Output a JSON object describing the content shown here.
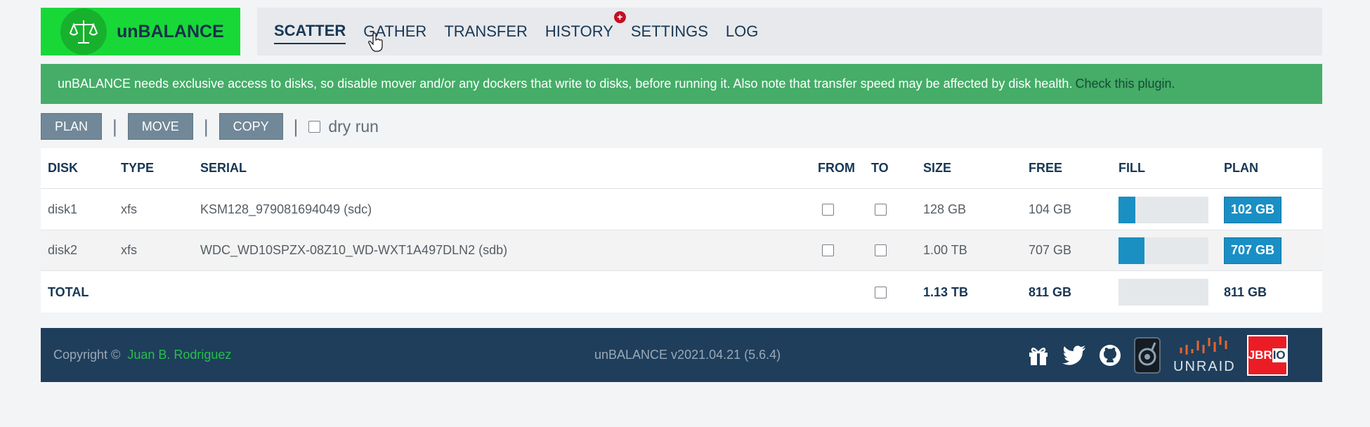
{
  "app": {
    "logo_text": "unBALANCE"
  },
  "nav": {
    "tabs": [
      {
        "label": "SCATTER",
        "active": true
      },
      {
        "label": "GATHER"
      },
      {
        "label": "TRANSFER"
      },
      {
        "label": "HISTORY",
        "badge": "+"
      },
      {
        "label": "SETTINGS"
      },
      {
        "label": "LOG"
      }
    ]
  },
  "alert": {
    "message": "unBALANCE needs exclusive access to disks, so disable mover and/or any dockers that write to disks, before running it. Also note that transfer speed may be affected by disk health.",
    "link": "Check this plugin."
  },
  "toolbar": {
    "plan_label": "PLAN",
    "move_label": "MOVE",
    "copy_label": "COPY",
    "separator": "|",
    "dry_run_label": "dry run",
    "dry_run_checked": false
  },
  "table": {
    "headers": {
      "disk": "DISK",
      "type": "TYPE",
      "serial": "SERIAL",
      "from": "FROM",
      "to": "TO",
      "size": "SIZE",
      "free": "FREE",
      "fill": "FILL",
      "plan": "PLAN"
    },
    "rows": [
      {
        "disk": "disk1",
        "type": "xfs",
        "serial": "KSM128_979081694049 (sdc)",
        "size": "128 GB",
        "free": "104 GB",
        "fill_percent": 19,
        "plan": "102 GB"
      },
      {
        "disk": "disk2",
        "type": "xfs",
        "serial": "WDC_WD10SPZX-08Z10_WD-WXT1A497DLN2 (sdb)",
        "size": "1.00 TB",
        "free": "707 GB",
        "fill_percent": 29,
        "plan": "707 GB"
      }
    ],
    "total": {
      "label": "TOTAL",
      "size": "1.13 TB",
      "free": "811 GB",
      "fill_percent": 0,
      "plan": "811 GB"
    }
  },
  "footer": {
    "copyright": "Copyright ©",
    "author": "Juan B. Rodriguez",
    "version": "unBALANCE v2021.04.21 (5.6.4)",
    "unraid_label": "UNRAID",
    "jbrio_label": "JBR",
    "jbrio_label_suffix": "IO"
  },
  "colors": {
    "logo_green": "#18d838",
    "alert_green": "#45ad68",
    "footer_navy": "#1e3e5c",
    "fill_blue": "#198fc2",
    "button_gray": "#718898"
  }
}
